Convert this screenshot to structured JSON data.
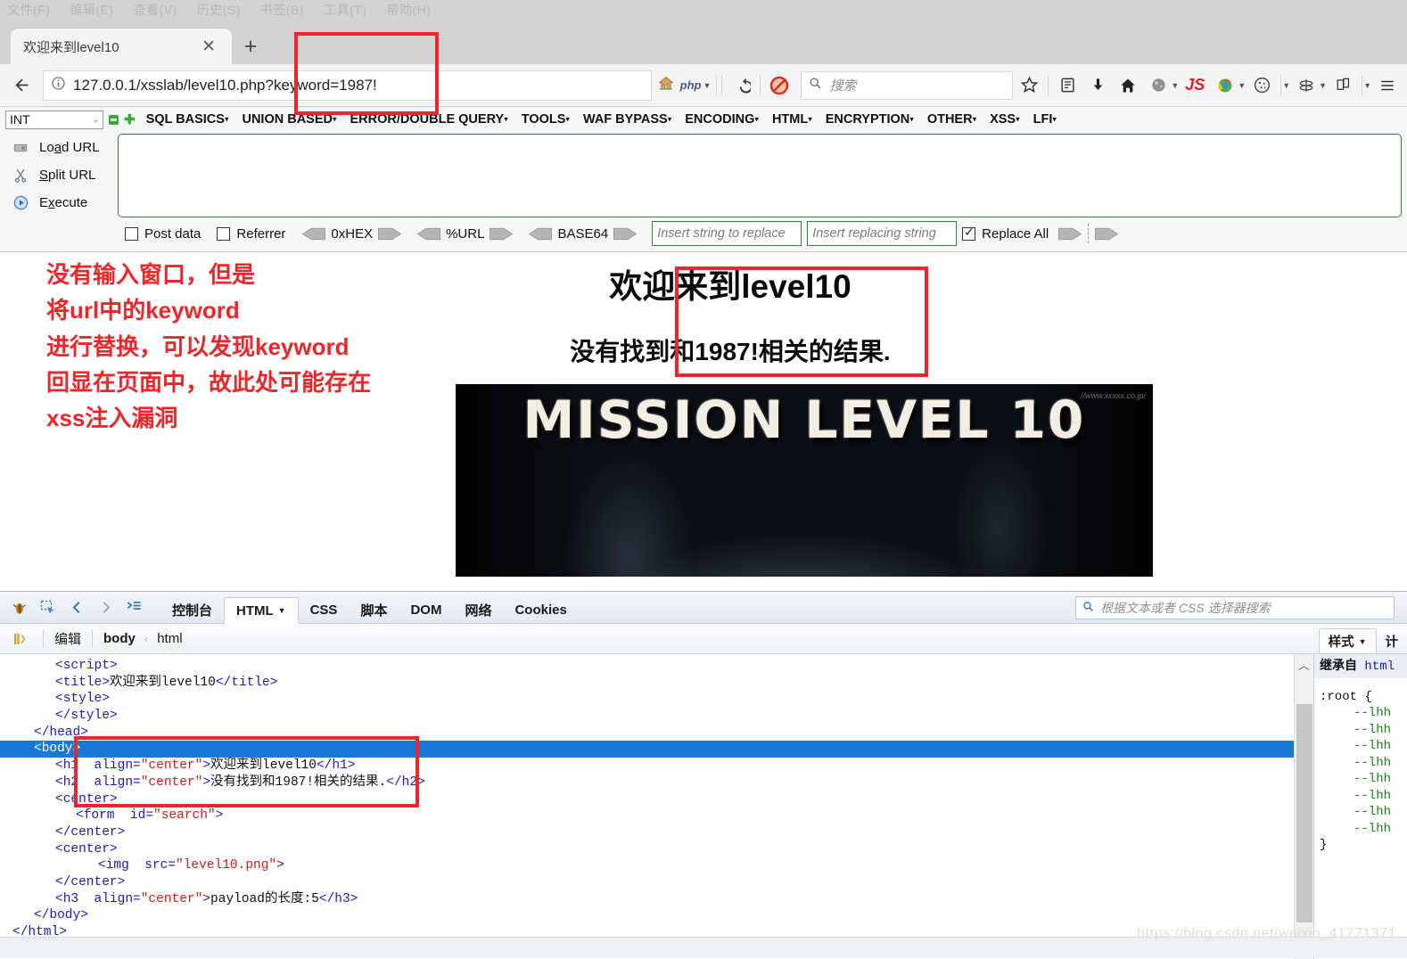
{
  "browser": {
    "menubar": [
      "文件(F)",
      "编辑(E)",
      "查看(V)",
      "历史(S)",
      "书签(B)",
      "工具(T)",
      "帮助(H)"
    ],
    "tab_title": "欢迎来到level10",
    "tab_close": "✕",
    "new_tab": "+",
    "url": "127.0.0.1/xsslab/level10.php?keyword=1987!",
    "php_label": "php",
    "search_placeholder": "搜索"
  },
  "hackbar": {
    "type_select": "INT",
    "menus": [
      "SQL BASICS",
      "UNION BASED",
      "ERROR/DOUBLE QUERY",
      "TOOLS",
      "WAF BYPASS",
      "ENCODING",
      "HTML",
      "ENCRYPTION",
      "OTHER",
      "XSS",
      "LFI"
    ],
    "actions": [
      {
        "label_pre": "Lo",
        "label_key": "a",
        "label_post": "d URL",
        "name": "load-url"
      },
      {
        "label_pre": "",
        "label_key": "S",
        "label_post": "plit URL",
        "name": "split-url"
      },
      {
        "label_pre": "E",
        "label_key": "x",
        "label_post": "ecute",
        "name": "execute"
      }
    ],
    "textarea_value": "",
    "post_data_label": "Post data",
    "referrer_label": "Referrer",
    "converters": [
      "0xHEX",
      "%URL",
      "BASE64"
    ],
    "replace_from_placeholder": "Insert string to replace",
    "replace_to_placeholder": "Insert replacing string",
    "replace_all_label": "Replace All"
  },
  "annotation": {
    "lines": [
      "没有输入窗口，但是",
      "将url中的keyword",
      "进行替换，可以发现keyword",
      "回显在页面中，故此处可能存在",
      "xss注入漏洞"
    ],
    "color": "#e8282b"
  },
  "page": {
    "h1": "欢迎来到level10",
    "h2": "没有找到和1987!相关的结果.",
    "banner_text": "MISSION LEVEL 10",
    "banner_watermark": "//www.xxxxx.co.jp/"
  },
  "devtools": {
    "tabs": [
      "控制台",
      "HTML",
      "CSS",
      "脚本",
      "DOM",
      "网络",
      "Cookies"
    ],
    "active_tab": "HTML",
    "search_placeholder": "根据文本或者 CSS 选择器搜索",
    "edit_label": "编辑",
    "breadcrumb": [
      "body",
      "html"
    ],
    "breadcrumb_sep": "‹",
    "right_tabs": [
      "样式",
      "计"
    ],
    "right_active": "样式",
    "code_lines": [
      {
        "indent": 2,
        "twisty": "+",
        "parts": [
          {
            "t": "tw",
            "v": "<script>"
          }
        ]
      },
      {
        "indent": 2,
        "twisty": "",
        "parts": [
          {
            "t": "tw",
            "v": "<title>"
          },
          {
            "t": "tx",
            "v": "欢迎来到level10"
          },
          {
            "t": "tw",
            "v": "</title>"
          }
        ]
      },
      {
        "indent": 2,
        "twisty": "−",
        "parts": [
          {
            "t": "tw",
            "v": "<style>"
          }
        ]
      },
      {
        "indent": 2,
        "twisty": "",
        "parts": [
          {
            "t": "tw",
            "v": "</style>"
          }
        ]
      },
      {
        "indent": 1,
        "twisty": "",
        "parts": [
          {
            "t": "tw",
            "v": "</head>"
          }
        ]
      },
      {
        "indent": 1,
        "twisty": "−",
        "sel": true,
        "parts": [
          {
            "t": "tw",
            "v": "<body>"
          }
        ]
      },
      {
        "indent": 2,
        "twisty": "",
        "parts": [
          {
            "t": "tw",
            "v": "<h1  align="
          },
          {
            "t": "av",
            "v": "\"center\""
          },
          {
            "t": "tw",
            "v": ">"
          },
          {
            "t": "tx",
            "v": "欢迎来到level10"
          },
          {
            "t": "tw",
            "v": "</h1>"
          }
        ]
      },
      {
        "indent": 2,
        "twisty": "",
        "parts": [
          {
            "t": "tw",
            "v": "<h2  align="
          },
          {
            "t": "av",
            "v": "\"center\""
          },
          {
            "t": "tw",
            "v": ">"
          },
          {
            "t": "tx",
            "v": "没有找到和1987!相关的结果."
          },
          {
            "t": "tw",
            "v": "</h2>"
          }
        ]
      },
      {
        "indent": 2,
        "twisty": "−",
        "parts": [
          {
            "t": "tw",
            "v": "<center>"
          }
        ]
      },
      {
        "indent": 3,
        "twisty": "+",
        "parts": [
          {
            "t": "tw",
            "v": "<form  id="
          },
          {
            "t": "av",
            "v": "\"search\""
          },
          {
            "t": "tw",
            "v": ">"
          }
        ]
      },
      {
        "indent": 2,
        "twisty": "",
        "parts": [
          {
            "t": "tw",
            "v": "</center>"
          }
        ]
      },
      {
        "indent": 2,
        "twisty": "−",
        "parts": [
          {
            "t": "tw",
            "v": "<center>"
          }
        ]
      },
      {
        "indent": 4,
        "twisty": "",
        "parts": [
          {
            "t": "tw",
            "v": "<img  src="
          },
          {
            "t": "av",
            "v": "\"level10.png\""
          },
          {
            "t": "tw",
            "v": ">"
          }
        ]
      },
      {
        "indent": 2,
        "twisty": "",
        "parts": [
          {
            "t": "tw",
            "v": "</center>"
          }
        ]
      },
      {
        "indent": 2,
        "twisty": "",
        "parts": [
          {
            "t": "tw",
            "v": "<h3  align="
          },
          {
            "t": "av",
            "v": "\"center\""
          },
          {
            "t": "tw",
            "v": ">"
          },
          {
            "t": "tx",
            "v": "payload的长度:5"
          },
          {
            "t": "tw",
            "v": "</h3>"
          }
        ]
      },
      {
        "indent": 1,
        "twisty": "",
        "parts": [
          {
            "t": "tw",
            "v": "</body>"
          }
        ]
      },
      {
        "indent": 0,
        "twisty": "",
        "parts": [
          {
            "t": "tw",
            "v": "</html>"
          }
        ]
      }
    ],
    "style_panel": {
      "inherit_label": "继承自",
      "inherit_target": "html",
      "selector": ":root {",
      "vars": [
        "--lhh",
        "--lhh",
        "--lhh",
        "--lhh",
        "--lhh",
        "--lhh",
        "--lhh",
        "--lhh"
      ],
      "close": "}"
    }
  },
  "watermark": "https://blog.csdn.net/weixin_41771371"
}
